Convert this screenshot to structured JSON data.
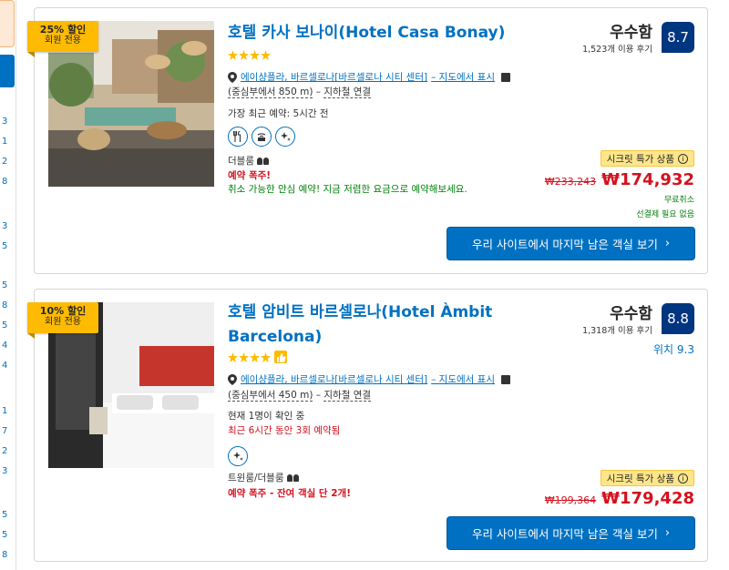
{
  "sidebar": {
    "numbers": [
      "3",
      "1",
      "2",
      "8",
      "3",
      "5",
      "5",
      "8",
      "5",
      "4",
      "4",
      "1",
      "7",
      "2",
      "3",
      "5",
      "5",
      "8"
    ]
  },
  "hotels": [
    {
      "badge_percent": "25% 할인",
      "badge_label": "회원 전용",
      "name": "호텔 카사 보나이(Hotel Casa Bonay)",
      "stars": 4,
      "location_link": "에이샹플라, 바르셀로나[바르셀로나 시티 센터]",
      "map_link": "– 지도에서 표시",
      "distance": "(중심부에서 850 m)",
      "metro": "지하철 연결",
      "recent_booking": "가장 최근 예약: 5시간 전",
      "room_type": "더블룸",
      "alert": "예약 폭주!",
      "cancellation": "취소 가능한 안심 예약! 지금 저렴한 요금으로 예약해보세요.",
      "rating_word": "우수함",
      "reviews": "1,523개 이용 후기",
      "score": "8.7",
      "secret_deal": "시크릿 특가 상품",
      "old_price": "₩233,243",
      "new_price": "₩174,932",
      "free_cancel": "무료취소",
      "no_prepay": "선결제 필요 없음",
      "cta": "우리 사이트에서 마지막 남은 객실 보기"
    },
    {
      "badge_percent": "10% 할인",
      "badge_label": "회원 전용",
      "name_line1": "호텔 암비트 바르셀로나(Hotel Àmbit",
      "name_line2": "Barcelona)",
      "stars": 4,
      "location_link": "에이샹플라, 바르셀로나[바르셀로나 시티 센터]",
      "map_link": "– 지도에서 표시",
      "distance": "(중심부에서 450 m)",
      "metro": "지하철 연결",
      "viewing": "현재 1명이 확인 중",
      "recent_booking": "최근 6시간 동안 3회 예약됨",
      "room_type": "트윈룸/더블룸",
      "alert": "예약 폭주 - 잔여 객실 단 2개!",
      "rating_word": "우수함",
      "reviews": "1,318개 이용 후기",
      "score": "8.8",
      "location_score": "위치 9.3",
      "secret_deal": "시크릿 특가 상품",
      "old_price": "₩199,364",
      "new_price": "₩179,428",
      "cta": "우리 사이트에서 마지막 남은 객실 보기"
    }
  ],
  "colors": {
    "link_blue": "#0071c2",
    "score_navy": "#003580",
    "badge_yellow": "#febb02",
    "price_red": "#d4111e",
    "green": "#008009"
  }
}
